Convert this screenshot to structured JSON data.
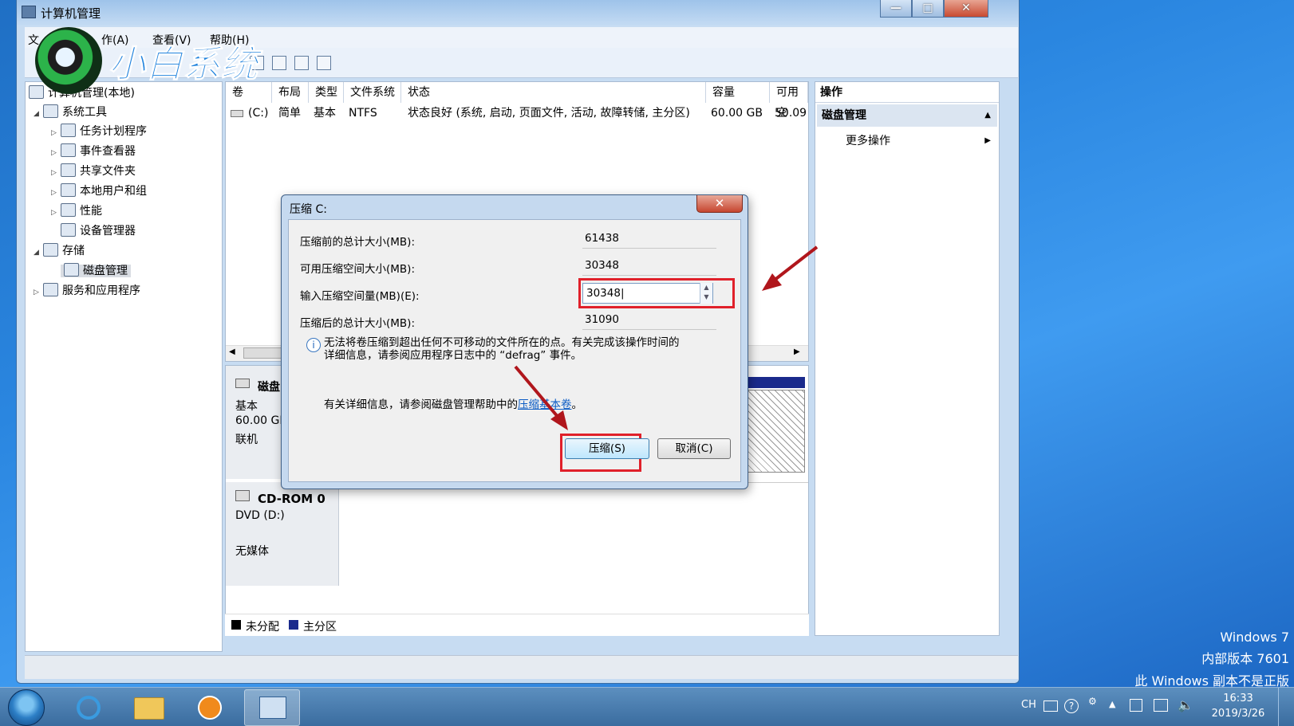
{
  "window": {
    "title": "计算机管理",
    "buttons": {
      "minimize": "—",
      "maximize": "□",
      "close": "✕"
    }
  },
  "menubar": {
    "items": [
      "文",
      "作(A)",
      "查看(V)",
      "帮助(H)"
    ]
  },
  "brand": {
    "text": "小白系统"
  },
  "tree": {
    "root": "计算机管理(本地)",
    "items": [
      {
        "label": "系统工具",
        "expanded": true,
        "icon": "tools-icon"
      },
      {
        "label": "任务计划程序",
        "icon": "clock-icon"
      },
      {
        "label": "事件查看器",
        "icon": "event-icon"
      },
      {
        "label": "共享文件夹",
        "icon": "folder-share-icon"
      },
      {
        "label": "本地用户和组",
        "icon": "users-icon"
      },
      {
        "label": "性能",
        "icon": "performance-icon"
      },
      {
        "label": "设备管理器",
        "icon": "device-icon"
      },
      {
        "label": "存储",
        "expanded": true,
        "icon": "storage-icon"
      },
      {
        "label": "磁盘管理",
        "icon": "disk-icon",
        "selected": true
      },
      {
        "label": "服务和应用程序",
        "icon": "services-icon"
      }
    ]
  },
  "volume_table": {
    "columns": [
      "卷",
      "布局",
      "类型",
      "文件系统",
      "状态",
      "容量",
      "可用空"
    ],
    "rows": [
      [
        "(C:)",
        "简单",
        "基本",
        "NTFS",
        "状态良好 (系统, 启动, 页面文件, 活动, 故障转储, 主分区)",
        "60.00 GB",
        "50.09"
      ]
    ]
  },
  "disks": {
    "disk0": {
      "name": "磁盘 (",
      "type": "基本",
      "size": "60.00 GB",
      "status": "联机"
    },
    "cdrom": {
      "name": "CD-ROM 0",
      "drive": "DVD (D:)",
      "status": "无媒体"
    },
    "legend": {
      "unallocated": "未分配",
      "primary": "主分区"
    }
  },
  "actions": {
    "header": "操作",
    "group": "磁盘管理",
    "more": "更多操作"
  },
  "dialog": {
    "title": "压缩 C:",
    "close": "✕",
    "fields": {
      "total_before_label": "压缩前的总计大小(MB):",
      "total_before_value": "61438",
      "available_label": "可用压缩空间大小(MB):",
      "available_value": "30348",
      "input_label": "输入压缩空间量(MB)(E):",
      "input_value": "30348",
      "total_after_label": "压缩后的总计大小(MB):",
      "total_after_value": "31090"
    },
    "info_line1": "无法将卷压缩到超出任何不可移动的文件所在的点。有关完成该操作时间的",
    "info_line2": "详细信息，请参阅应用程序日志中的 “defrag” 事件。",
    "help_prefix": "有关详细信息，请参阅磁盘管理帮助中的",
    "help_link": "压缩基本卷",
    "help_suffix": "。",
    "shrink_button": "压缩(S)",
    "cancel_button": "取消(C)"
  },
  "taskbar": {
    "lang": "CH",
    "time": "16:33",
    "date": "2019/3/26"
  },
  "watermark": {
    "line1": "Windows 7",
    "line2": "内部版本 7601",
    "line3": "此 Windows 副本不是正版"
  },
  "colors": {
    "primary_partition": "#1a2a8c",
    "highlight": "#e0202a"
  }
}
